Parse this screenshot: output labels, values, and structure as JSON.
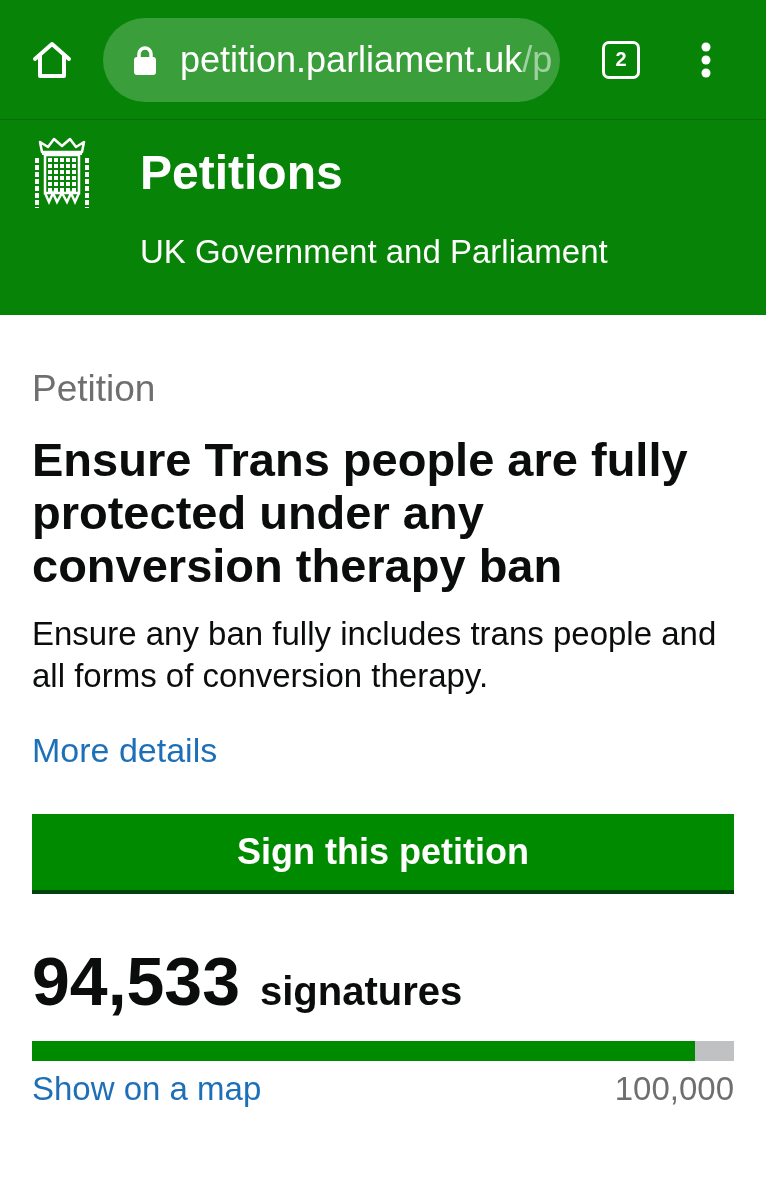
{
  "browser_bar": {
    "address_bar": {
      "secure": true,
      "host": "petition.parliament.uk",
      "path": "/p"
    },
    "tab_count": "2"
  },
  "header": {
    "title": "Petitions",
    "subtitle": "UK Government and Parliament"
  },
  "petition": {
    "label": "Petition",
    "title": "Ensure Trans people are fully protected under any conversion therapy ban",
    "summary": "Ensure any ban fully includes trans people and all forms of conversion therapy.",
    "details_link": "More details",
    "sign_button": "Sign this petition"
  },
  "signatures": {
    "count": "94,533",
    "unit": "signatures",
    "progress": {
      "level": 0.945
    },
    "map_link": "Show on a map",
    "threshold": "100,000"
  }
}
